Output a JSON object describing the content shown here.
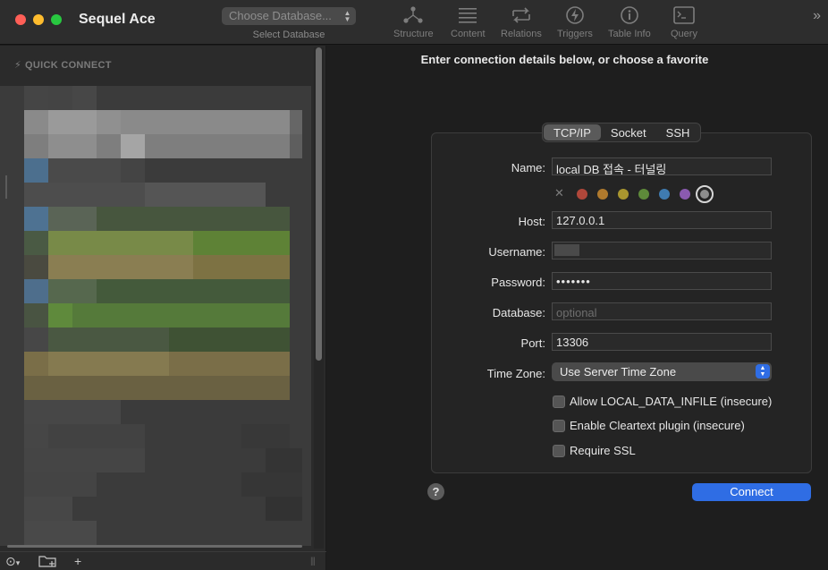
{
  "app": {
    "title": "Sequel Ace"
  },
  "toolbar": {
    "db_select_placeholder": "Choose Database...",
    "db_select_caption": "Select Database",
    "items": [
      {
        "label": "Structure",
        "icon": "structure-icon"
      },
      {
        "label": "Content",
        "icon": "content-icon"
      },
      {
        "label": "Relations",
        "icon": "relations-icon"
      },
      {
        "label": "Triggers",
        "icon": "triggers-icon"
      },
      {
        "label": "Table Info",
        "icon": "table-info-icon"
      },
      {
        "label": "Query",
        "icon": "query-icon"
      }
    ],
    "overflow_glyph": "»"
  },
  "sidebar": {
    "section_label": "QUICK CONNECT",
    "bottom": {
      "menu_glyph": "☺",
      "add_glyph": "+"
    }
  },
  "main": {
    "heading": "Enter connection details below, or choose a favorite",
    "tabs": [
      {
        "label": "TCP/IP",
        "active": true
      },
      {
        "label": "Socket",
        "active": false
      },
      {
        "label": "SSH",
        "active": false
      }
    ],
    "form": {
      "name_label": "Name:",
      "name_value": "local DB 접속 - 터널링",
      "host_label": "Host:",
      "host_value": "127.0.0.1",
      "username_label": "Username:",
      "password_label": "Password:",
      "password_value": "•••••••",
      "database_label": "Database:",
      "database_placeholder": "optional",
      "port_label": "Port:",
      "port_value": "13306",
      "timezone_label": "Time Zone:",
      "timezone_value": "Use Server Time Zone"
    },
    "colors": [
      "#b0473a",
      "#b07a2d",
      "#a9962f",
      "#5e8a3a",
      "#3f7bb0",
      "#8a5ab0",
      "#8d8d8d"
    ],
    "checkboxes": [
      {
        "label": "Allow LOCAL_DATA_INFILE (insecure)",
        "checked": false
      },
      {
        "label": "Enable Cleartext plugin (insecure)",
        "checked": false
      },
      {
        "label": "Require SSL",
        "checked": false
      }
    ],
    "help_glyph": "?",
    "connect_label": "Connect"
  }
}
